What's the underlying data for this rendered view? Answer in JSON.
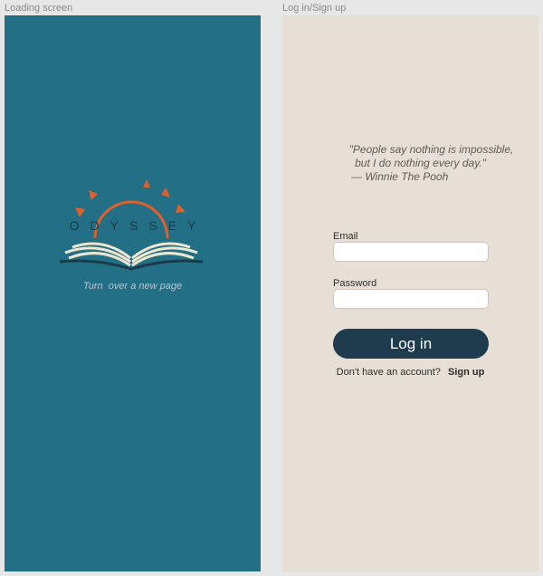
{
  "frames": {
    "loading_label": "Loading screen",
    "login_label": "Log in/Sign up"
  },
  "loading": {
    "brand_name": "ODYSSEY",
    "tagline": "Turn  over a new page"
  },
  "login": {
    "quote": {
      "line1": "\"People say nothing is impossible,",
      "line2": "but I do nothing every day.\"",
      "line3": "— Winnie The Pooh"
    },
    "email_label": "Email",
    "email_value": "",
    "password_label": "Password",
    "password_value": "",
    "login_button": "Log in",
    "signup_prompt": "Don't have an account?",
    "signup_link": "Sign up"
  },
  "colors": {
    "loading_bg": "#236f86",
    "login_bg": "#e7dfd5",
    "sun_orange": "#e0602b",
    "button_navy": "#1f3c4e",
    "book_cream": "#efe6cf"
  }
}
